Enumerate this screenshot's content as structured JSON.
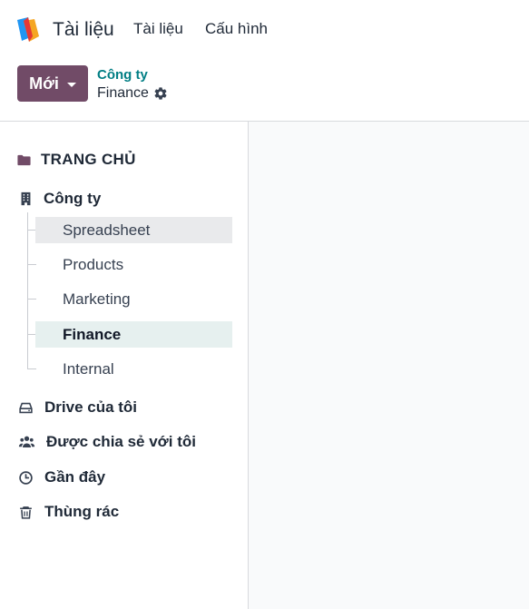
{
  "app": {
    "name": "Tài liệu"
  },
  "nav": {
    "items": [
      {
        "label": "Tài liệu"
      },
      {
        "label": "Cấu hình"
      }
    ]
  },
  "control": {
    "new_label": "Mới",
    "breadcrumb_parent": "Công ty",
    "breadcrumb_current": "Finance"
  },
  "sidebar": {
    "root_label": "TRANG CHỦ",
    "company_label": "Công ty",
    "children": [
      {
        "label": "Spreadsheet"
      },
      {
        "label": "Products"
      },
      {
        "label": "Marketing"
      },
      {
        "label": "Finance"
      },
      {
        "label": "Internal"
      }
    ],
    "bottom": [
      {
        "label": "Drive của tôi",
        "icon": "hard-drive-icon"
      },
      {
        "label": "Được chia sẻ với tôi",
        "icon": "users-icon"
      },
      {
        "label": "Gần đây",
        "icon": "clock-icon"
      },
      {
        "label": "Thùng rác",
        "icon": "trash-icon"
      }
    ]
  },
  "colors": {
    "brand": "#714b67",
    "breadcrumb": "#017e84",
    "active_bg": "#e6f0ef",
    "hover_bg": "#e9eaec"
  }
}
